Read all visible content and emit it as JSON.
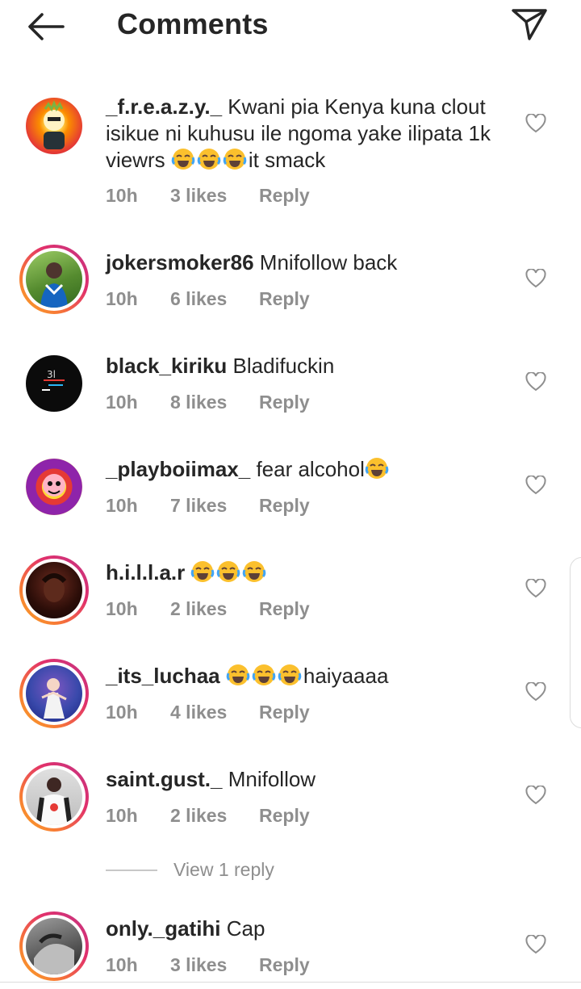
{
  "header": {
    "title": "Comments",
    "back_icon": "arrow-left-icon",
    "send_icon": "paper-plane-icon"
  },
  "colors": {
    "text": "#262626",
    "meta": "#8e8e8e",
    "story_ring": [
      "#f9a825",
      "#e1306c",
      "#c13584"
    ]
  },
  "comments": [
    {
      "username": "_f.r.e.a.z.y._",
      "text": "Kwani pia Kenya kuna clout isikue ni kuhusu ile ngoma yake ilipata 1k viewrs",
      "emoji_count": 3,
      "trailing_text": "it smack",
      "time": "10h",
      "likes": "3 likes",
      "reply_label": "Reply",
      "story_ring": false
    },
    {
      "username": "jokersmoker86",
      "text": "Mnifollow back",
      "emoji_count": 0,
      "trailing_text": "",
      "time": "10h",
      "likes": "6 likes",
      "reply_label": "Reply",
      "story_ring": true
    },
    {
      "username": "black_kiriku",
      "text": "Bladifuckin",
      "emoji_count": 0,
      "trailing_text": "",
      "time": "10h",
      "likes": "8 likes",
      "reply_label": "Reply",
      "story_ring": false
    },
    {
      "username": "_playboiimax_",
      "text": "fear alcohol",
      "emoji_count": 1,
      "trailing_text": "",
      "time": "10h",
      "likes": "7 likes",
      "reply_label": "Reply",
      "story_ring": false
    },
    {
      "username": "h.i.l.l.a.r",
      "text": "",
      "emoji_count": 3,
      "trailing_text": "",
      "time": "10h",
      "likes": "2 likes",
      "reply_label": "Reply",
      "story_ring": true
    },
    {
      "username": "_its_luchaa",
      "text": "",
      "emoji_count": 3,
      "trailing_text": "haiyaaaa",
      "time": "10h",
      "likes": "4 likes",
      "reply_label": "Reply",
      "story_ring": true
    },
    {
      "username": "saint.gust._",
      "text": "Mnifollow",
      "emoji_count": 0,
      "trailing_text": "",
      "time": "10h",
      "likes": "2 likes",
      "reply_label": "Reply",
      "story_ring": true,
      "view_replies_label": "View 1 reply"
    },
    {
      "username": "only._gatihi",
      "text": "Cap",
      "emoji_count": 0,
      "trailing_text": "",
      "time": "10h",
      "likes": "3 likes",
      "reply_label": "Reply",
      "story_ring": true
    }
  ]
}
